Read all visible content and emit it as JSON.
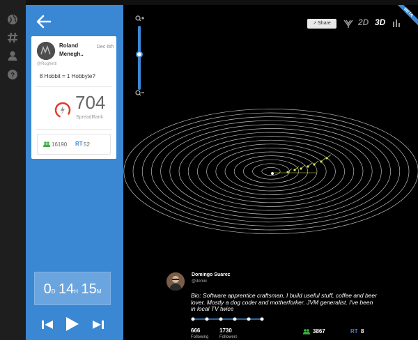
{
  "tweet_card": {
    "author_name": "Roland Menegh..",
    "date": "Dec 6th",
    "handle": "@Roghetti",
    "text": "8 Hobbit = 1 Hobbyte?",
    "spread_rank": "704",
    "spread_rank_label": "SpreadRank",
    "followers_count": "16190",
    "rt_label": "RT",
    "rt_count": "52"
  },
  "timer": {
    "days": "0",
    "days_unit": "D",
    "hours": "14",
    "hours_unit": "H",
    "minutes": "15",
    "minutes_unit": "M"
  },
  "toolbar": {
    "share_label": "Share",
    "mode_2d": "2D",
    "mode_3d": "3D",
    "beta_label": "BETA",
    "active_mode": "3D"
  },
  "profile": {
    "name": "Domingo Suarez",
    "handle": "@domix",
    "bio": "Bio: Software apprentice craftsman, I build useful stuff, coffee and beer lover. Mostly a dog coder and motherforker. JVM generalist. I've been in local TV twice",
    "following_count": "666",
    "following_label": "Following",
    "followers_count": "1730",
    "followers_label": "Followers",
    "stat_followers": "3867",
    "rt_label": "RT",
    "rt_count": "8"
  },
  "colors": {
    "accent": "#3a87d4",
    "followers_green": "#3cb043",
    "gauge_red": "#e03a2f",
    "points_yellow": "#d8e55a"
  },
  "icons": [
    "globe-icon",
    "hashtag-icon",
    "user-icon",
    "help-icon",
    "back-arrow-icon",
    "users-icon",
    "play-icon",
    "rewind-icon",
    "forward-icon",
    "zoom-in-icon",
    "zoom-out-icon",
    "share-icon",
    "bar-chart-icon"
  ]
}
